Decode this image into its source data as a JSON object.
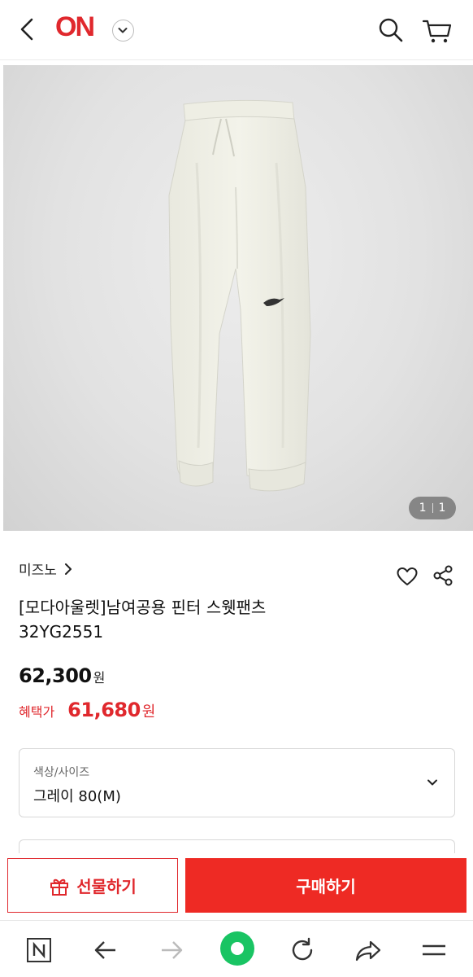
{
  "header": {
    "logo": "ON",
    "brand_color": "#e0282d"
  },
  "gallery": {
    "current": "1",
    "total": "1"
  },
  "product": {
    "brand": "미즈노",
    "title_line1": "[모다아울렛]남여공용 핀터 스웻팬츠",
    "title_line2": "32YG2551",
    "price": "62,300",
    "price_unit": "원",
    "benefit_label": "혜택가",
    "benefit_price": "61,680",
    "benefit_unit": "원"
  },
  "option": {
    "label": "색상/사이즈",
    "value": "그레이 80(M)"
  },
  "cta": {
    "gift_label": "선물하기",
    "buy_label": "구매하기"
  },
  "icons": {
    "back": "chevron-left-icon",
    "dropdown": "chevron-down-icon",
    "search": "search-icon",
    "cart": "cart-icon",
    "wishlist": "heart-icon",
    "share": "share-icon",
    "gift": "gift-icon",
    "browser_home": "naver-n-icon",
    "browser_back": "arrow-left-icon",
    "browser_forward": "arrow-right-icon",
    "browser_green": "green-dot-icon",
    "browser_reload": "reload-icon",
    "browser_share": "forward-share-icon",
    "browser_menu": "menu-icon"
  },
  "colors": {
    "accent": "#e0282d",
    "buy_button": "#ee2a24",
    "browser_green": "#19c463"
  }
}
